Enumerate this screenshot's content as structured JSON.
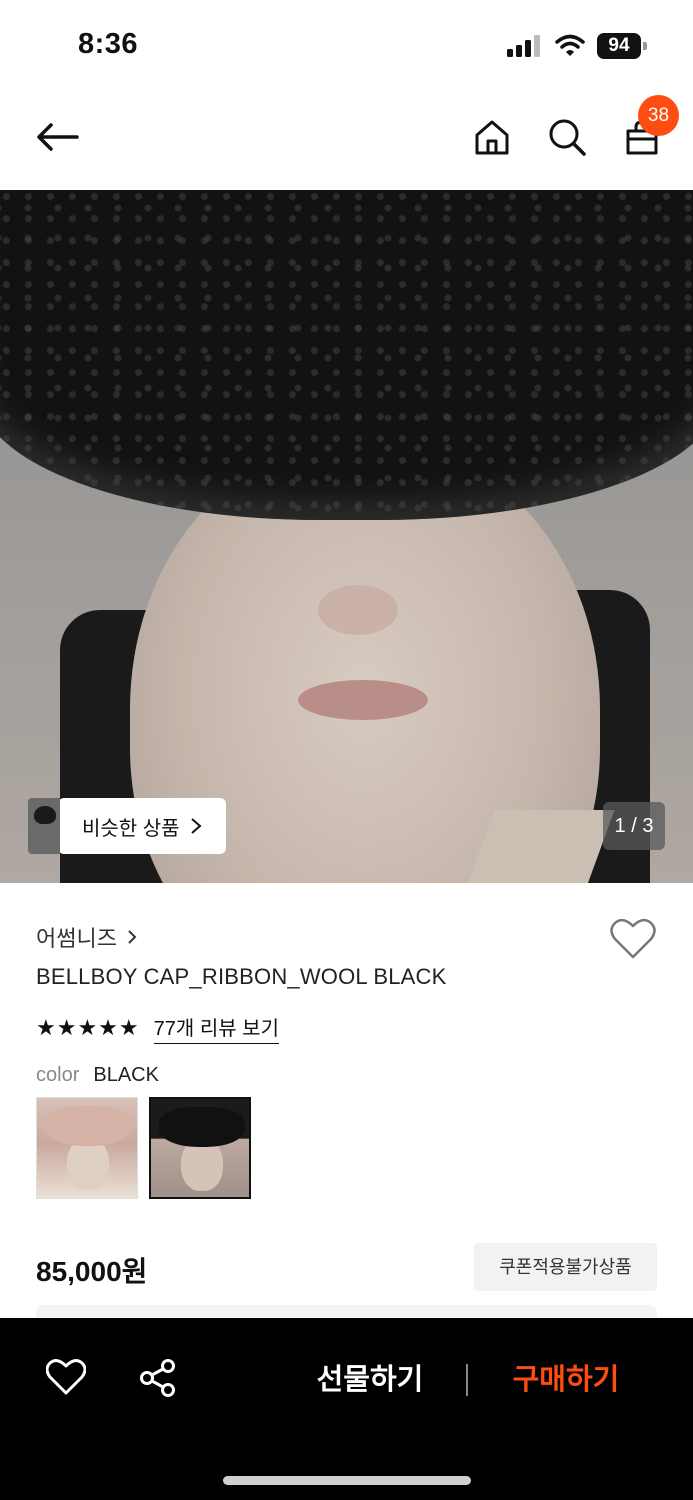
{
  "status_bar": {
    "time": "8:36",
    "battery": "94"
  },
  "nav": {
    "cart_count": "38"
  },
  "hero": {
    "similar_label": "비슷한 상품",
    "page_indicator": "1 / 3"
  },
  "product": {
    "brand": "어썸니즈",
    "title": "BELLBOY CAP_RIBBON_WOOL BLACK",
    "rating_stars": "★★★★★",
    "rating_value": 5,
    "review_link": "77개 리뷰 보기",
    "color_label": "color",
    "color_value": "BLACK",
    "price": "85,000원",
    "coupon_tag": "쿠폰적용불가상품"
  },
  "bottom_bar": {
    "gift_label": "선물하기",
    "buy_label": "구매하기"
  },
  "colors": {
    "accent": "#ff4d12",
    "bottom_bar_bg": "#000000"
  }
}
